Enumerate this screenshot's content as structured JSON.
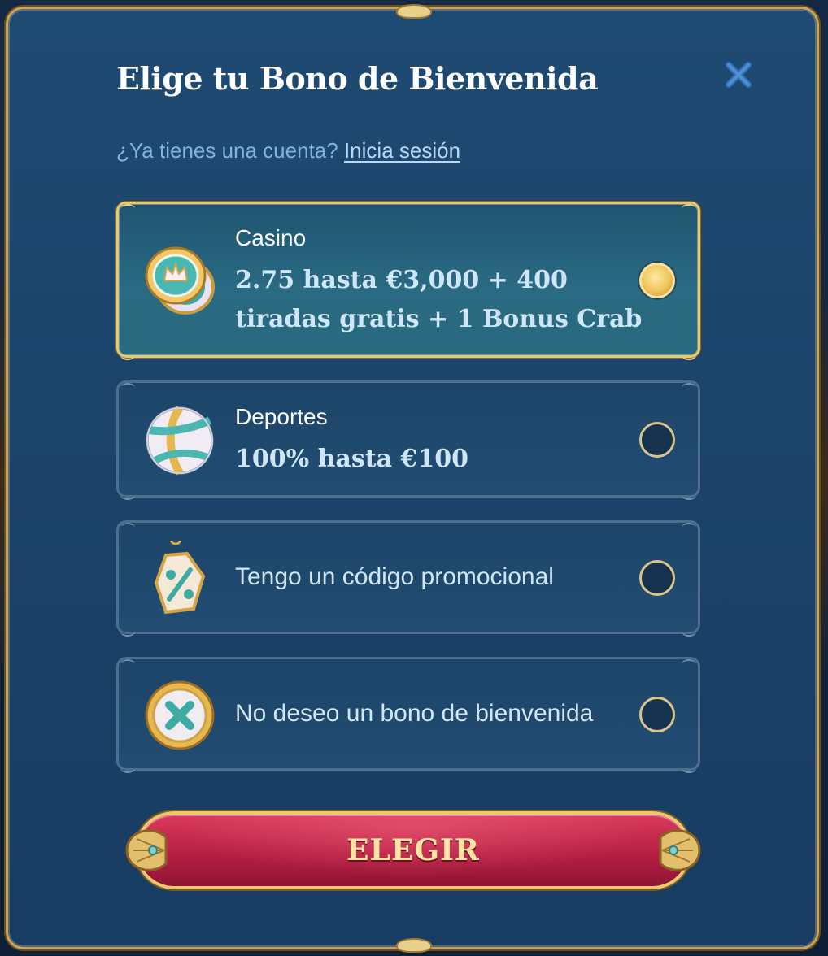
{
  "modal": {
    "title": "Elige tu Bono de Bienvenida",
    "login_prompt": "¿Ya tienes una cuenta?",
    "login_link": "Inicia sesión"
  },
  "options": [
    {
      "label": "Casino",
      "desc_line1": "2.75 hasta €3,000 + 400",
      "desc_line2": "tiradas gratis + 1 Bonus Crab",
      "icon": "casino-chips-icon",
      "selected": true
    },
    {
      "label": "Deportes",
      "desc_line1": "100% hasta €100",
      "icon": "volleyball-icon",
      "selected": false
    },
    {
      "label": "Tengo un código promocional",
      "icon": "promo-tag-icon",
      "selected": false
    },
    {
      "label": "No deseo un bono de bienvenida",
      "icon": "no-bonus-x-icon",
      "selected": false
    }
  ],
  "submit": {
    "label": "ELEGIR"
  },
  "colors": {
    "accent_gold": "#e8c873",
    "button_red": "#c42b50",
    "link_blue": "#7fb3e3",
    "panel_blue": "#1d4569"
  }
}
